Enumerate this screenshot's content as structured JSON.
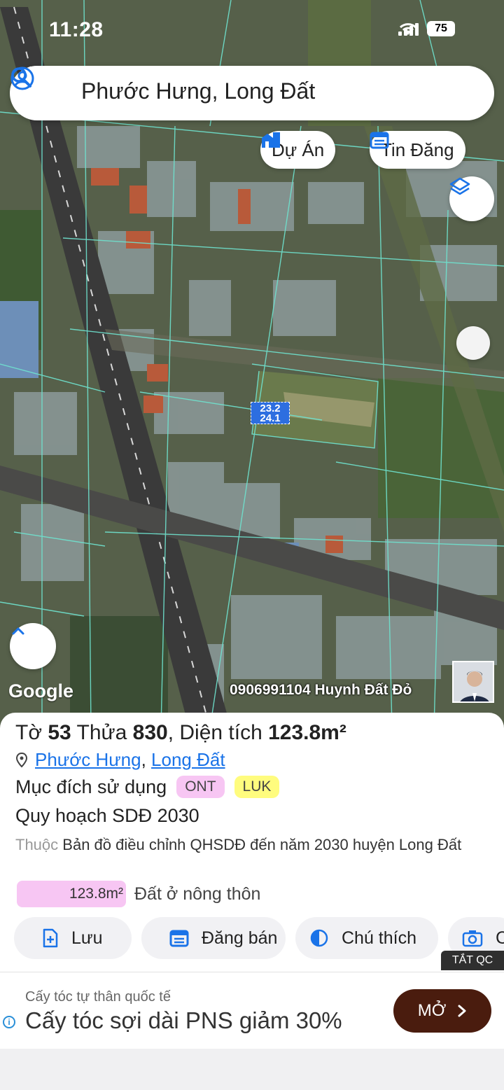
{
  "status_bar": {
    "time": "11:28",
    "battery": "75"
  },
  "search": {
    "value": "Phước Hưng, Long Đất"
  },
  "chips": {
    "projects": "Dự Án",
    "listings": "Tin Đăng"
  },
  "map": {
    "lot_label_line1": "23.2",
    "lot_label_line2": "24.1",
    "google": "Google",
    "watermark": "0906991104 Huynh Đất Đỏ"
  },
  "parcel": {
    "sheet_label": "Tờ",
    "sheet_no": "53",
    "plot_label": "Thửa",
    "plot_no": "830",
    "area_label": ", Diện tích",
    "area_value": "123.8m²",
    "ward": "Phước Hưng",
    "district": "Long Đất",
    "purpose_label": "Mục đích sử dụng",
    "tags": [
      "ONT",
      "LUK"
    ],
    "plan_title": "Quy hoạch SDĐ 2030",
    "belongs_prefix": "Thuộc",
    "belongs_text": "Bản đồ điều chỉnh QHSDĐ đến năm 2030 huyện Long Đất",
    "legend_area": "123.8m²",
    "legend_text": "Đất ở nông thôn"
  },
  "actions": {
    "save": "Lưu",
    "post": "Đăng bán",
    "legend": "Chú thích",
    "capture": "C"
  },
  "ad": {
    "close_label": "TẮT QC",
    "sub": "Cấy tóc tự thân quốc tế",
    "headline": "Cấy tóc sợi dài PNS giảm 30%",
    "cta": "MỞ"
  },
  "colors": {
    "accent": "#1a73e8",
    "ont": "#f7c6f3",
    "luk": "#fffc7e",
    "ad_button": "#4a1c0e"
  }
}
